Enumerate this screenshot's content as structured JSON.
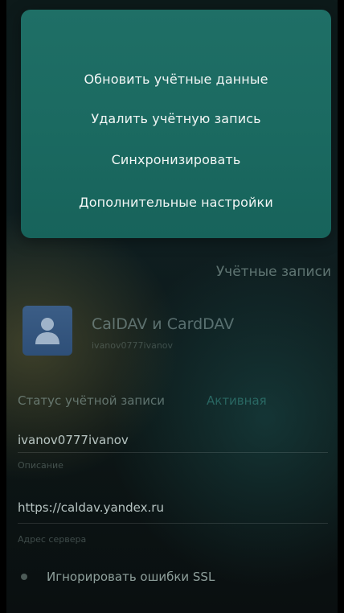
{
  "menu": {
    "items": [
      "Обновить учётные данные",
      "Удалить учётную запись",
      "Синхронизировать",
      "Дополнительные настройки"
    ]
  },
  "section": {
    "title": "Учётные записи"
  },
  "account": {
    "title": "CalDAV и CardDAV",
    "subtitle": "ivanov0777ivanov",
    "avatar_icon": "person-icon"
  },
  "status": {
    "label": "Статус учётной записи",
    "value": "Активная"
  },
  "fields": {
    "description": {
      "value": "ivanov0777ivanov",
      "hint": "Описание"
    },
    "server": {
      "value": "https://caldav.yandex.ru",
      "hint": "Адрес сервера"
    }
  },
  "options": {
    "ignore_ssl": "Игнорировать ошибки SSL"
  },
  "colors": {
    "menu_bg": "#1b6a61",
    "accent": "#3c968c",
    "avatar_bg": "#2e4f78"
  }
}
